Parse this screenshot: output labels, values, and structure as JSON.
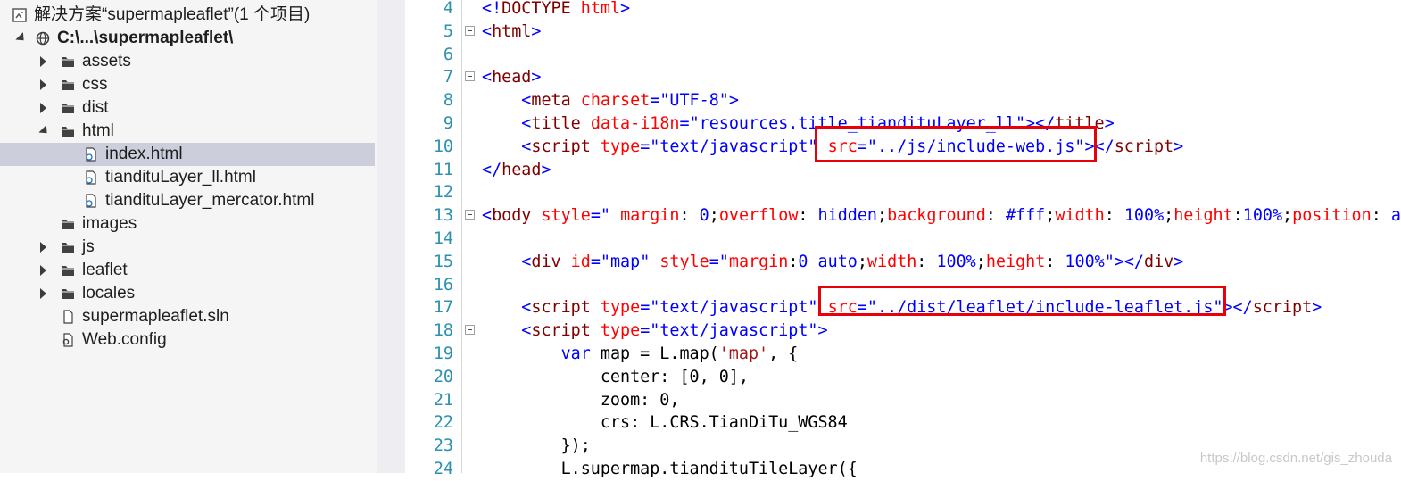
{
  "explorer": {
    "solution_label": "解决方案“supermapleaflet”(1 个项目)",
    "project_label": "C:\\...\\supermapleaflet\\",
    "items": [
      {
        "label": "assets"
      },
      {
        "label": "css"
      },
      {
        "label": "dist"
      },
      {
        "label": "html"
      },
      {
        "label": "index.html"
      },
      {
        "label": "tiandituLayer_ll.html"
      },
      {
        "label": "tiandituLayer_mercator.html"
      },
      {
        "label": "images"
      },
      {
        "label": "js"
      },
      {
        "label": "leaflet"
      },
      {
        "label": "locales"
      },
      {
        "label": "supermapleaflet.sln"
      },
      {
        "label": "Web.config"
      }
    ],
    "selected_item": "index.html"
  },
  "editor": {
    "lines": [
      {
        "n": "4",
        "fold": false,
        "tokens": [
          [
            "punct",
            "<!"
          ],
          [
            "tag",
            "DOCTYPE"
          ],
          [
            "plain",
            " "
          ],
          [
            "attr",
            "html"
          ],
          [
            "punct",
            ">"
          ]
        ]
      },
      {
        "n": "5",
        "fold": true,
        "tokens": [
          [
            "punct",
            "<"
          ],
          [
            "tag",
            "html"
          ],
          [
            "punct",
            ">"
          ]
        ]
      },
      {
        "n": "6",
        "fold": false,
        "tokens": []
      },
      {
        "n": "7",
        "fold": true,
        "tokens": [
          [
            "punct",
            "<"
          ],
          [
            "tag",
            "head"
          ],
          [
            "punct",
            ">"
          ]
        ]
      },
      {
        "n": "8",
        "fold": false,
        "tokens": [
          [
            "plain",
            "    "
          ],
          [
            "punct",
            "<"
          ],
          [
            "tag",
            "meta"
          ],
          [
            "plain",
            " "
          ],
          [
            "attr",
            "charset"
          ],
          [
            "punct",
            "="
          ],
          [
            "val",
            "\"UTF-8\""
          ],
          [
            "punct",
            ">"
          ]
        ]
      },
      {
        "n": "9",
        "fold": false,
        "tokens": [
          [
            "plain",
            "    "
          ],
          [
            "punct",
            "<"
          ],
          [
            "tag",
            "title"
          ],
          [
            "plain",
            " "
          ],
          [
            "attr",
            "data-i18n"
          ],
          [
            "punct",
            "="
          ],
          [
            "val",
            "\"resources.title_tiandituLayer_ll\""
          ],
          [
            "punct",
            "></"
          ],
          [
            "tag",
            "title"
          ],
          [
            "punct",
            ">"
          ]
        ]
      },
      {
        "n": "10",
        "fold": false,
        "tokens": [
          [
            "plain",
            "    "
          ],
          [
            "punct",
            "<"
          ],
          [
            "tag",
            "script"
          ],
          [
            "plain",
            " "
          ],
          [
            "attr",
            "type"
          ],
          [
            "punct",
            "="
          ],
          [
            "val",
            "\"text/javascript\""
          ],
          [
            "plain",
            " "
          ],
          [
            "attr",
            "src"
          ],
          [
            "punct",
            "="
          ],
          [
            "val",
            "\"../js/include-web.js\""
          ],
          [
            "punct",
            "></"
          ],
          [
            "tag",
            "script"
          ],
          [
            "punct",
            ">"
          ]
        ]
      },
      {
        "n": "11",
        "fold": false,
        "tokens": [
          [
            "punct",
            "</"
          ],
          [
            "tag",
            "head"
          ],
          [
            "punct",
            ">"
          ]
        ]
      },
      {
        "n": "12",
        "fold": false,
        "tokens": []
      },
      {
        "n": "13",
        "fold": true,
        "tokens": [
          [
            "punct",
            "<"
          ],
          [
            "tag",
            "body"
          ],
          [
            "plain",
            " "
          ],
          [
            "attr",
            "style"
          ],
          [
            "punct",
            "=\""
          ],
          [
            "plain",
            " "
          ],
          [
            "attr",
            "margin"
          ],
          [
            "plain",
            ": "
          ],
          [
            "val",
            "0"
          ],
          [
            "plain",
            ";"
          ],
          [
            "attr",
            "overflow"
          ],
          [
            "plain",
            ": "
          ],
          [
            "val",
            "hidden"
          ],
          [
            "plain",
            ";"
          ],
          [
            "attr",
            "background"
          ],
          [
            "plain",
            ": "
          ],
          [
            "val",
            "#fff"
          ],
          [
            "plain",
            ";"
          ],
          [
            "attr",
            "width"
          ],
          [
            "plain",
            ": "
          ],
          [
            "val",
            "100%"
          ],
          [
            "plain",
            ";"
          ],
          [
            "attr",
            "height"
          ],
          [
            "plain",
            ":"
          ],
          [
            "val",
            "100%"
          ],
          [
            "plain",
            ";"
          ],
          [
            "attr",
            "position"
          ],
          [
            "plain",
            ": "
          ],
          [
            "val",
            "ab"
          ]
        ]
      },
      {
        "n": "14",
        "fold": false,
        "tokens": []
      },
      {
        "n": "15",
        "fold": false,
        "tokens": [
          [
            "plain",
            "    "
          ],
          [
            "punct",
            "<"
          ],
          [
            "tag",
            "div"
          ],
          [
            "plain",
            " "
          ],
          [
            "attr",
            "id"
          ],
          [
            "punct",
            "="
          ],
          [
            "val",
            "\"map\""
          ],
          [
            "plain",
            " "
          ],
          [
            "attr",
            "style"
          ],
          [
            "punct",
            "=\""
          ],
          [
            "attr",
            "margin"
          ],
          [
            "plain",
            ":"
          ],
          [
            "val",
            "0 auto"
          ],
          [
            "plain",
            ";"
          ],
          [
            "attr",
            "width"
          ],
          [
            "plain",
            ": "
          ],
          [
            "val",
            "100%"
          ],
          [
            "plain",
            ";"
          ],
          [
            "attr",
            "height"
          ],
          [
            "plain",
            ": "
          ],
          [
            "val",
            "100%"
          ],
          [
            "punct",
            "\"></"
          ],
          [
            "tag",
            "div"
          ],
          [
            "punct",
            ">"
          ]
        ]
      },
      {
        "n": "16",
        "fold": false,
        "tokens": []
      },
      {
        "n": "17",
        "fold": false,
        "tokens": [
          [
            "plain",
            "    "
          ],
          [
            "punct",
            "<"
          ],
          [
            "tag",
            "script"
          ],
          [
            "plain",
            " "
          ],
          [
            "attr",
            "type"
          ],
          [
            "punct",
            "="
          ],
          [
            "val",
            "\"text/javascript\""
          ],
          [
            "plain",
            " "
          ],
          [
            "attr",
            "src"
          ],
          [
            "punct",
            "="
          ],
          [
            "val",
            "\"../dist/leaflet/include-leaflet.js\""
          ],
          [
            "punct",
            "></"
          ],
          [
            "tag",
            "script"
          ],
          [
            "punct",
            ">"
          ]
        ]
      },
      {
        "n": "18",
        "fold": true,
        "tokens": [
          [
            "plain",
            "    "
          ],
          [
            "punct",
            "<"
          ],
          [
            "tag",
            "script"
          ],
          [
            "plain",
            " "
          ],
          [
            "attr",
            "type"
          ],
          [
            "punct",
            "="
          ],
          [
            "val",
            "\"text/javascript\""
          ],
          [
            "punct",
            ">"
          ]
        ]
      },
      {
        "n": "19",
        "fold": false,
        "tokens": [
          [
            "plain",
            "        "
          ],
          [
            "kw",
            "var"
          ],
          [
            "plain",
            " map = L.map("
          ],
          [
            "str",
            "'map'"
          ],
          [
            "plain",
            ", {"
          ]
        ]
      },
      {
        "n": "20",
        "fold": false,
        "tokens": [
          [
            "plain",
            "            center: [0, 0],"
          ]
        ]
      },
      {
        "n": "21",
        "fold": false,
        "tokens": [
          [
            "plain",
            "            zoom: 0,"
          ]
        ]
      },
      {
        "n": "22",
        "fold": false,
        "tokens": [
          [
            "plain",
            "            crs: L.CRS.TianDiTu_WGS84"
          ]
        ]
      },
      {
        "n": "23",
        "fold": false,
        "tokens": [
          [
            "plain",
            "        });"
          ]
        ]
      },
      {
        "n": "24",
        "fold": false,
        "tokens": [
          [
            "plain",
            "        L.supermap.tiandituTileLayer({"
          ]
        ]
      }
    ]
  },
  "highlight_color": "#e8000b",
  "watermark": "https://blog.csdn.net/gis_zhouda"
}
